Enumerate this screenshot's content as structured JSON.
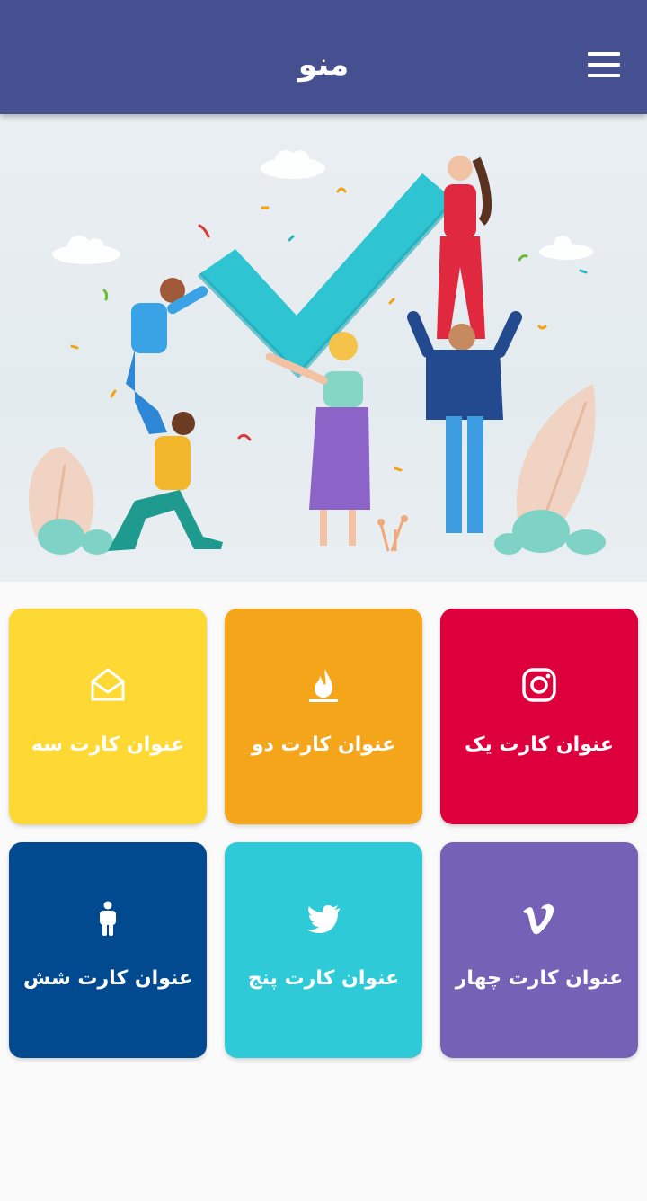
{
  "appbar": {
    "title": "منو",
    "menu_icon": "hamburger-menu-icon",
    "background": "#464f8f"
  },
  "banner": {
    "illustration": "teamwork-checkmark-illustration",
    "slide_indicator": "carousel-dot"
  },
  "cards": [
    {
      "title": "عنوان کارت یک",
      "icon": "instagram-icon",
      "color": "#dd003d"
    },
    {
      "title": "عنوان کارت دو",
      "icon": "flame-icon",
      "color": "#f5a51a"
    },
    {
      "title": "عنوان کارت سه",
      "icon": "open-envelope-icon",
      "color": "#fed933"
    },
    {
      "title": "عنوان کارت چهار",
      "icon": "vimeo-icon",
      "color": "#7562b7"
    },
    {
      "title": "عنوان کارت پنج",
      "icon": "twitter-icon",
      "color": "#2fcad8"
    },
    {
      "title": "عنوان کارت شش",
      "icon": "person-icon",
      "color": "#014a8f"
    }
  ]
}
